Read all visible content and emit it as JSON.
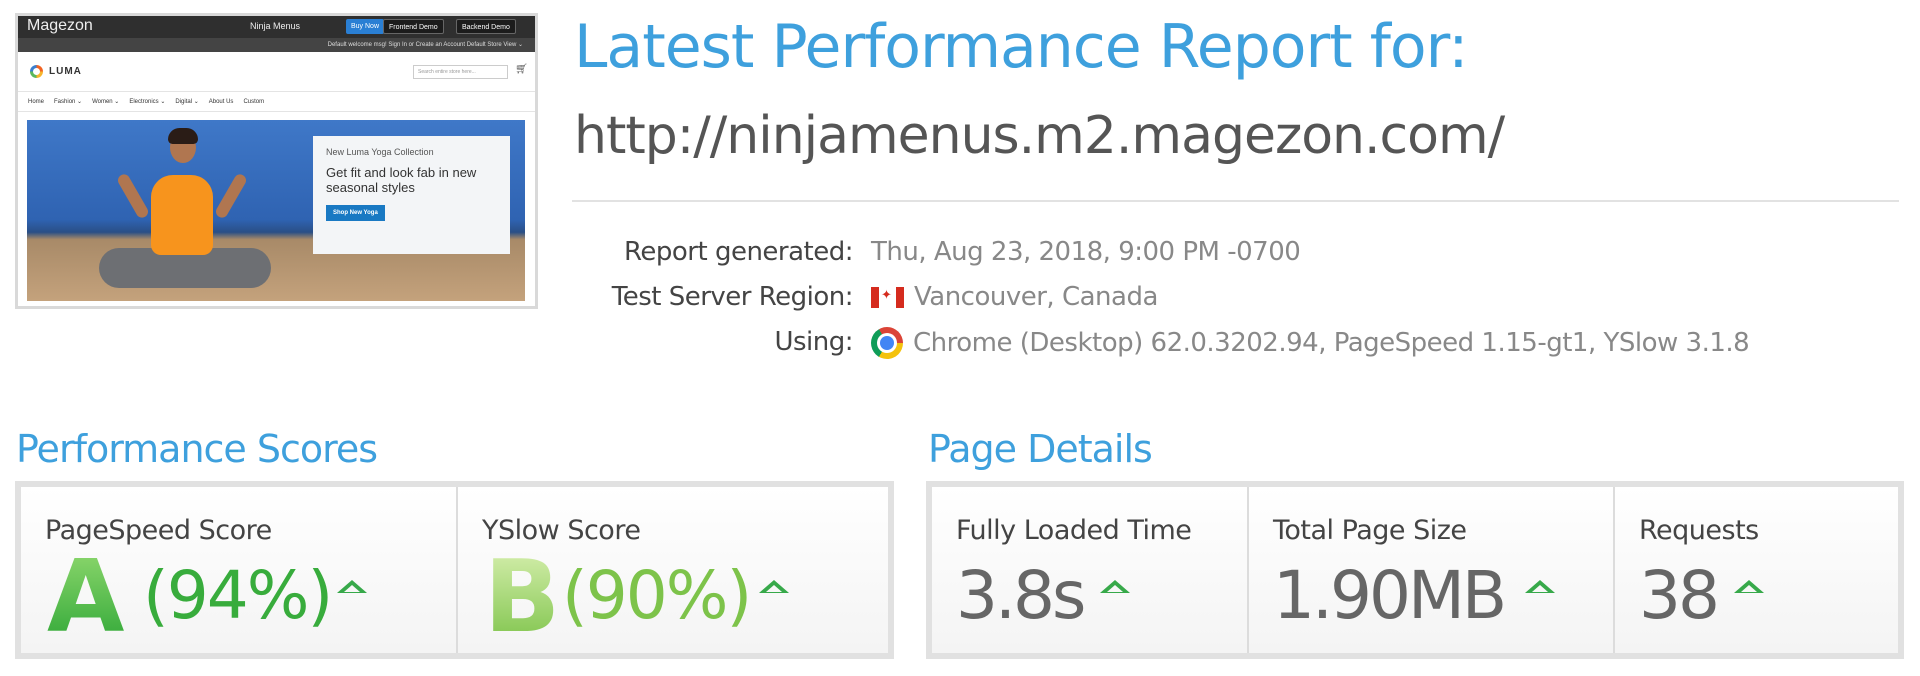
{
  "thumbnail": {
    "brand": "Magezon",
    "site_title": "Ninja Menus",
    "buy_now": "Buy Now",
    "frontend_demo": "Frontend Demo",
    "backend_demo": "Backend Demo",
    "top_links": "Default welcome msg!  Sign In  or  Create an Account   Default Store View ⌄",
    "logo": "LUMA",
    "search_placeholder": "Search entire store here...",
    "nav": [
      "Home",
      "Fashion ⌄",
      "Women ⌄",
      "Electronics ⌄",
      "Digital ⌄",
      "About Us",
      "Custom"
    ],
    "promo_kicker": "New Luma Yoga Collection",
    "promo_heading": "Get fit and look fab in new seasonal styles",
    "promo_button": "Shop New Yoga"
  },
  "report": {
    "title": "Latest Performance Report for:",
    "url": "http://ninjamenus.m2.magezon.com/",
    "generated_label": "Report generated:",
    "generated_value": "Thu, Aug 23, 2018, 9:00 PM -0700",
    "region_label": "Test Server Region:",
    "region_value": "Vancouver, Canada",
    "using_label": "Using:",
    "using_value": "Chrome (Desktop) 62.0.3202.94, PageSpeed 1.15-gt1, YSlow 3.1.8"
  },
  "performance": {
    "title": "Performance Scores",
    "pagespeed_label": "PageSpeed Score",
    "pagespeed_grade": "A",
    "pagespeed_pct": "(94%)",
    "yslow_label": "YSlow Score",
    "yslow_grade": "B",
    "yslow_pct": "(90%)"
  },
  "details": {
    "title": "Page Details",
    "load_label": "Fully Loaded Time",
    "load_value": "3.8s",
    "size_label": "Total Page Size",
    "size_value": "1.90MB",
    "requests_label": "Requests",
    "requests_value": "38"
  },
  "colors": {
    "accent": "#3ea0dd",
    "grade_a": "#38ac3c",
    "grade_b": "#7dc34a",
    "trend_up": "#37a94a"
  },
  "icons": {
    "region": "canada-flag-icon",
    "browser": "chrome-icon",
    "trend": "arrow-up-icon"
  }
}
